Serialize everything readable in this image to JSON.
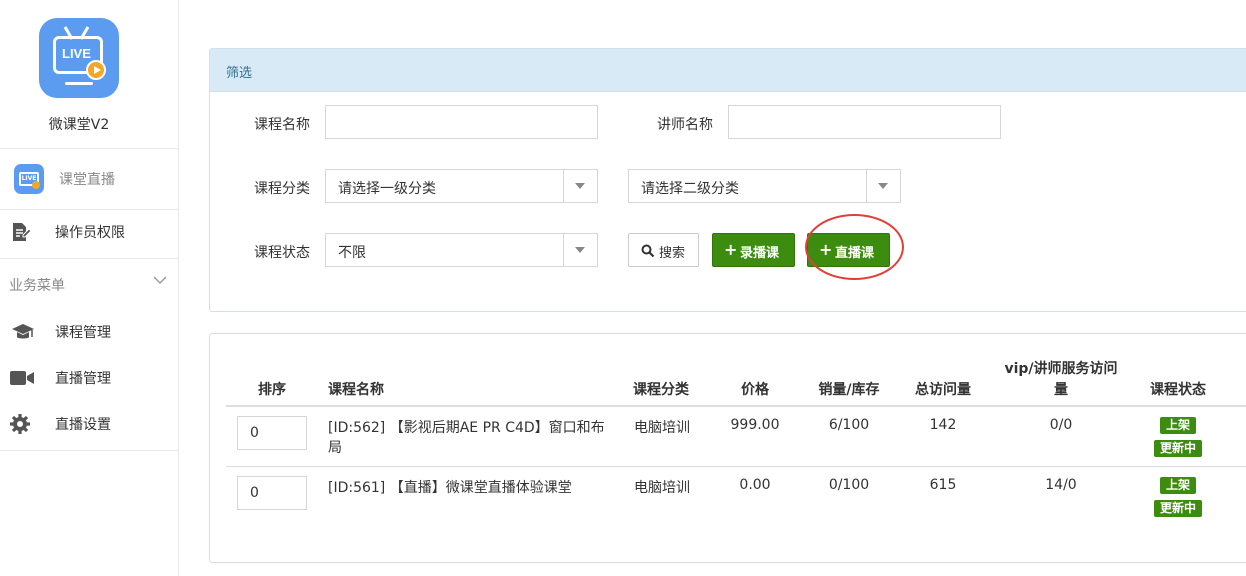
{
  "app": {
    "name": "微课堂V2",
    "logo_text": "LIVE"
  },
  "sidebar": {
    "top_items": [
      {
        "label": "课堂直播",
        "icon": "live-tv-icon"
      },
      {
        "label": "操作员权限",
        "icon": "edit-document-icon"
      }
    ],
    "group_label": "业务菜单",
    "group_items": [
      {
        "label": "课程管理",
        "icon": "graduation-cap-icon"
      },
      {
        "label": "直播管理",
        "icon": "video-camera-icon"
      },
      {
        "label": "直播设置",
        "icon": "gear-icon"
      }
    ]
  },
  "filter": {
    "title": "筛选",
    "course_name_label": "课程名称",
    "course_name_value": "",
    "teacher_name_label": "讲师名称",
    "teacher_name_value": "",
    "category_label": "课程分类",
    "category1_selected": "请选择一级分类",
    "category2_selected": "请选择二级分类",
    "status_label": "课程状态",
    "status_selected": "不限",
    "search_button": "搜索",
    "recorded_button": "录播课",
    "live_button": "直播课"
  },
  "table": {
    "headers": {
      "sort": "排序",
      "name": "课程名称",
      "category": "课程分类",
      "price": "价格",
      "sales": "销量/库存",
      "visits": "总访问量",
      "vip_line1": "vip/讲师服务访问",
      "vip_line2": "量",
      "status": "课程状态"
    },
    "rows": [
      {
        "sort": "0",
        "name_line1": "[ID:562] 【影视后期AE PR C4D】窗口和布",
        "name_line2": "局",
        "category": "电脑培训",
        "price": "999.00",
        "sales": "6/100",
        "visits": "142",
        "vip": "0/0",
        "status1": "上架",
        "status2": "更新中"
      },
      {
        "sort": "0",
        "name_line1": "[ID:561] 【直播】微课堂直播体验课堂",
        "name_line2": "",
        "category": "电脑培训",
        "price": "0.00",
        "sales": "0/100",
        "visits": "615",
        "vip": "14/0",
        "status1": "上架",
        "status2": "更新中"
      }
    ]
  },
  "colors": {
    "accent_green": "#3c8d0f",
    "panel_header": "#d9eaf7",
    "logo_blue": "#5b9cf0",
    "highlight_red": "#e0403a"
  }
}
